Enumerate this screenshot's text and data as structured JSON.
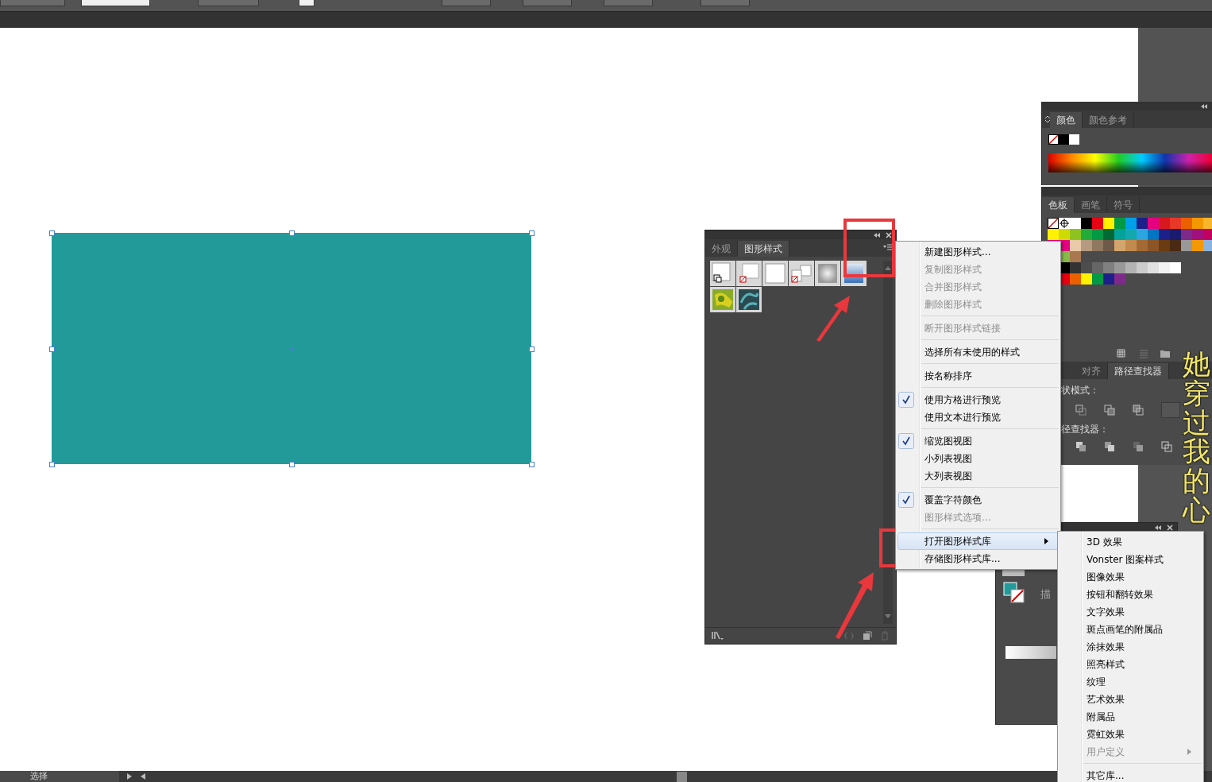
{
  "artboard": {
    "rectangle": {
      "selected": true
    }
  },
  "graphic_styles_panel": {
    "tabs": [
      {
        "label": "外观",
        "selected": false
      },
      {
        "label": "图形样式",
        "selected": true
      }
    ]
  },
  "panel_menu": {
    "items": [
      {
        "kind": "item",
        "label": "新建图形样式...",
        "checked": false,
        "disabled": false,
        "selected": false,
        "submenu": false
      },
      {
        "kind": "item",
        "label": "复制图形样式",
        "checked": false,
        "disabled": true,
        "selected": false,
        "submenu": false
      },
      {
        "kind": "item",
        "label": "合并图形样式",
        "checked": false,
        "disabled": true,
        "selected": false,
        "submenu": false
      },
      {
        "kind": "item",
        "label": "删除图形样式",
        "checked": false,
        "disabled": true,
        "selected": false,
        "submenu": false
      },
      {
        "kind": "separator"
      },
      {
        "kind": "item",
        "label": "断开图形样式链接",
        "checked": false,
        "disabled": true,
        "selected": false,
        "submenu": false
      },
      {
        "kind": "separator"
      },
      {
        "kind": "item",
        "label": "选择所有未使用的样式",
        "checked": false,
        "disabled": false,
        "selected": false,
        "submenu": false
      },
      {
        "kind": "separator"
      },
      {
        "kind": "item",
        "label": "按名称排序",
        "checked": false,
        "disabled": false,
        "selected": false,
        "submenu": false
      },
      {
        "kind": "separator"
      },
      {
        "kind": "item",
        "label": "使用方格进行预览",
        "checked": true,
        "disabled": false,
        "selected": false,
        "submenu": false
      },
      {
        "kind": "item",
        "label": "使用文本进行预览",
        "checked": false,
        "disabled": false,
        "selected": false,
        "submenu": false
      },
      {
        "kind": "separator"
      },
      {
        "kind": "item",
        "label": "缩览图视图",
        "checked": true,
        "disabled": false,
        "selected": false,
        "submenu": false
      },
      {
        "kind": "item",
        "label": "小列表视图",
        "checked": false,
        "disabled": false,
        "selected": false,
        "submenu": false
      },
      {
        "kind": "item",
        "label": "大列表视图",
        "checked": false,
        "disabled": false,
        "selected": false,
        "submenu": false
      },
      {
        "kind": "separator"
      },
      {
        "kind": "item",
        "label": "覆盖字符颜色",
        "checked": true,
        "disabled": false,
        "selected": false,
        "submenu": false
      },
      {
        "kind": "item",
        "label": "图形样式选项...",
        "checked": false,
        "disabled": true,
        "selected": false,
        "submenu": false
      },
      {
        "kind": "separator"
      },
      {
        "kind": "item",
        "label": "打开图形样式库",
        "checked": false,
        "disabled": false,
        "selected": true,
        "submenu": true
      },
      {
        "kind": "item",
        "label": "存储图形样式库...",
        "checked": false,
        "disabled": false,
        "selected": false,
        "submenu": false
      }
    ]
  },
  "library_submenu": {
    "items": [
      {
        "kind": "item",
        "label": "3D 效果",
        "disabled": false,
        "submenu": false
      },
      {
        "kind": "item",
        "label": "Vonster 图案样式",
        "disabled": false,
        "submenu": false
      },
      {
        "kind": "item",
        "label": "图像效果",
        "disabled": false,
        "submenu": false
      },
      {
        "kind": "item",
        "label": "按钮和翻转效果",
        "disabled": false,
        "submenu": false
      },
      {
        "kind": "item",
        "label": "文字效果",
        "disabled": false,
        "submenu": false
      },
      {
        "kind": "item",
        "label": "斑点画笔的附属品",
        "disabled": false,
        "submenu": false
      },
      {
        "kind": "item",
        "label": "涂抹效果",
        "disabled": false,
        "submenu": false
      },
      {
        "kind": "item",
        "label": "照亮样式",
        "disabled": false,
        "submenu": false
      },
      {
        "kind": "item",
        "label": "纹理",
        "disabled": false,
        "submenu": false
      },
      {
        "kind": "item",
        "label": "艺术效果",
        "disabled": false,
        "submenu": false
      },
      {
        "kind": "item",
        "label": "附属品",
        "disabled": false,
        "submenu": false
      },
      {
        "kind": "item",
        "label": "霓虹效果",
        "disabled": false,
        "submenu": false
      },
      {
        "kind": "item",
        "label": "用户定义",
        "disabled": true,
        "submenu": true
      },
      {
        "kind": "separator"
      },
      {
        "kind": "item",
        "label": "其它库...",
        "disabled": false,
        "submenu": false
      }
    ]
  },
  "color_panel": {
    "tabs": [
      {
        "label": "颜色",
        "selected": true
      },
      {
        "label": "颜色参考",
        "selected": false
      }
    ]
  },
  "swatches_panel": {
    "tabs": [
      {
        "label": "色板",
        "selected": true
      },
      {
        "label": "画笔",
        "selected": false
      },
      {
        "label": "符号",
        "selected": false
      }
    ]
  },
  "pathfinder_panel": {
    "tabs": [
      {
        "label": "对齐",
        "selected": false
      },
      {
        "label": "路径查找器",
        "selected": true
      }
    ],
    "shape_modes_label": "状模式：",
    "pathfinders_label": "径查找器："
  },
  "stroke_panel": {
    "label": "描"
  },
  "lyrics": {
    "text": "她穿过我的心"
  },
  "status_bar": {
    "tool": "选择"
  }
}
